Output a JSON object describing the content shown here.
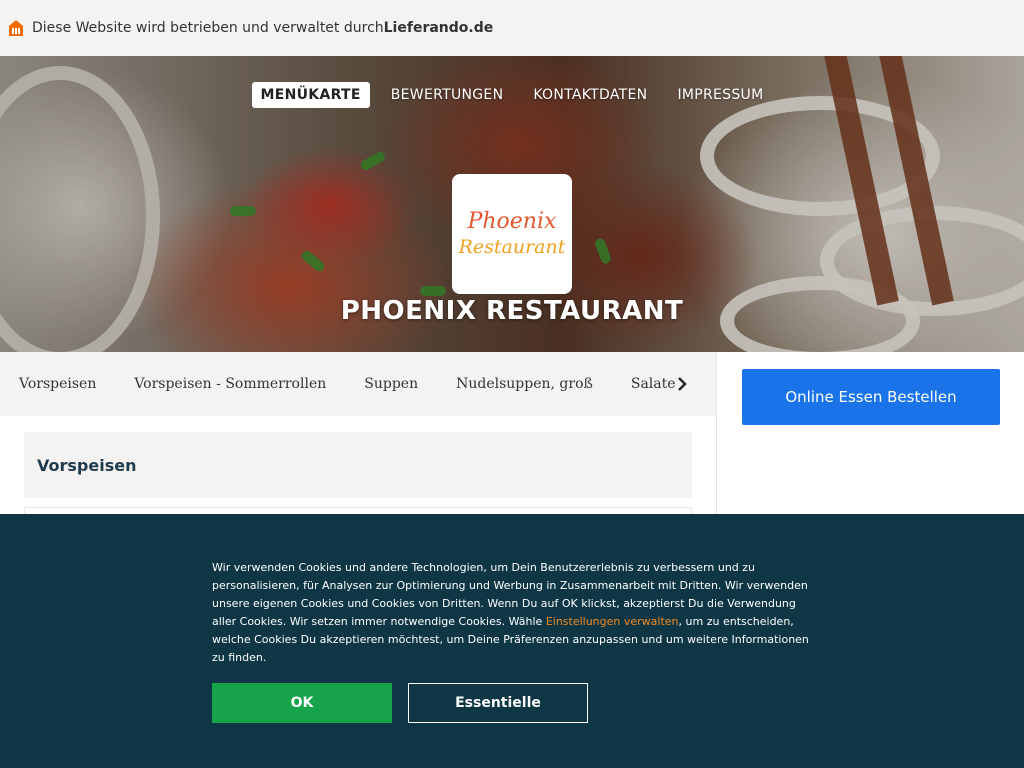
{
  "topbar": {
    "text": "Diese Website wird betrieben und verwaltet durch ",
    "brand": "Lieferando.de",
    "icon": "house-icon",
    "icon_color": "#f36d00"
  },
  "nav": {
    "items": [
      {
        "label": "MENÜKARTE",
        "active": true
      },
      {
        "label": "BEWERTUNGEN",
        "active": false
      },
      {
        "label": "KONTAKTDATEN",
        "active": false
      },
      {
        "label": "IMPRESSUM",
        "active": false
      }
    ]
  },
  "restaurant": {
    "logo_line1": "Phoenix",
    "logo_line2": "Restaurant",
    "name": "PHOENIX RESTAURANT"
  },
  "categories": {
    "items": [
      "Vorspeisen",
      "Vorspeisen - Sommerrollen",
      "Suppen",
      "Nudelsuppen, groß",
      "Salate"
    ],
    "next_icon": "chevron-right-icon"
  },
  "sidebar": {
    "order_label": "Online Essen Bestellen",
    "order_color": "#1a73e8"
  },
  "section": {
    "title": "Vorspeisen"
  },
  "cookie": {
    "text_before": "Wir verwenden Cookies und andere Technologien, um Dein Benutzererlebnis zu verbessern und zu personalisieren, für Analysen zur Optimierung und Werbung in Zusammenarbeit mit Dritten. Wir verwenden unsere eigenen Cookies und Cookies von Dritten. Wenn Du auf OK klickst, akzeptierst Du die Verwendung aller Cookies. Wir setzen immer notwendige Cookies. Wähle ",
    "link": "Einstellungen verwalten",
    "text_after": ", um zu entscheiden, welche Cookies Du akzeptieren möchtest, um Deine Präferenzen anzupassen und um weitere Informationen zu finden.",
    "ok_label": "OK",
    "essential_label": "Essentielle",
    "background": "#0e3645",
    "ok_color": "#17a34a",
    "link_color": "#f08a24"
  }
}
